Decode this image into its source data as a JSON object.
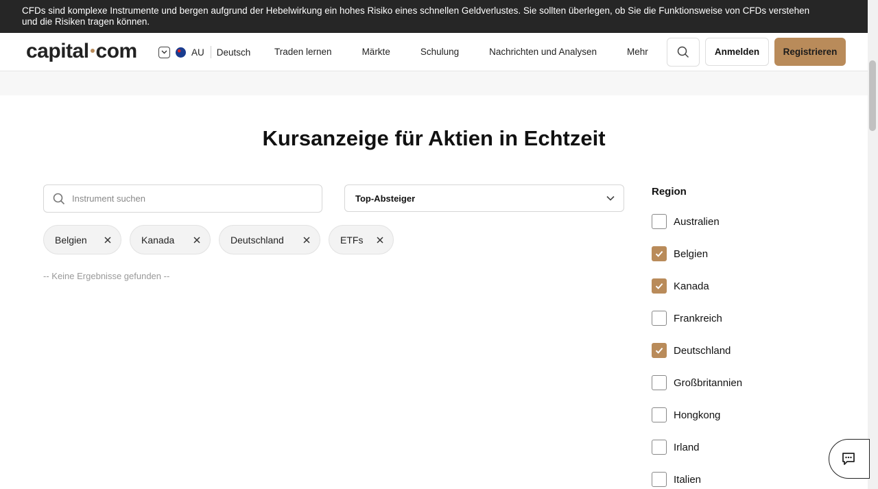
{
  "risk_banner": {
    "line1": "CFDs sind komplexe Instrumente und bergen aufgrund der Hebelwirkung ein hohes Risiko eines schnellen Geldverlustes. Sie sollten überlegen, ob Sie die Funktionsweise von CFDs verstehen",
    "line2": "und die Risiken tragen können."
  },
  "header": {
    "logo_left": "capital",
    "logo_right": "com",
    "region_code": "AU",
    "language": "Deutsch",
    "nav": [
      "Traden lernen",
      "Märkte",
      "Schulung",
      "Nachrichten und Analysen",
      "Mehr"
    ],
    "login_label": "Anmelden",
    "register_label": "Registrieren"
  },
  "main": {
    "title": "Kursanzeige für Aktien in Echtzeit",
    "search": {
      "placeholder": "Instrument suchen",
      "value": ""
    },
    "sort": {
      "selected": "Top-Absteiger"
    },
    "chips": [
      "Belgien",
      "Kanada",
      "Deutschland",
      "ETFs"
    ],
    "no_results": "-- Keine Ergebnisse gefunden --"
  },
  "filters": {
    "region_heading": "Region",
    "regions": [
      {
        "label": "Australien",
        "checked": false
      },
      {
        "label": "Belgien",
        "checked": true
      },
      {
        "label": "Kanada",
        "checked": true
      },
      {
        "label": "Frankreich",
        "checked": false
      },
      {
        "label": "Deutschland",
        "checked": true
      },
      {
        "label": "Großbritannien",
        "checked": false
      },
      {
        "label": "Hongkong",
        "checked": false
      },
      {
        "label": "Irland",
        "checked": false
      },
      {
        "label": "Italien",
        "checked": false
      }
    ]
  },
  "colors": {
    "accent": "#b98b5a",
    "banner_bg": "#262626"
  },
  "icons": {
    "search": "search-icon",
    "chevron": "chevron-down-icon",
    "chip_remove": "close-icon",
    "checkbox": "checkmark-icon",
    "chat": "chat-bubble-icon"
  }
}
